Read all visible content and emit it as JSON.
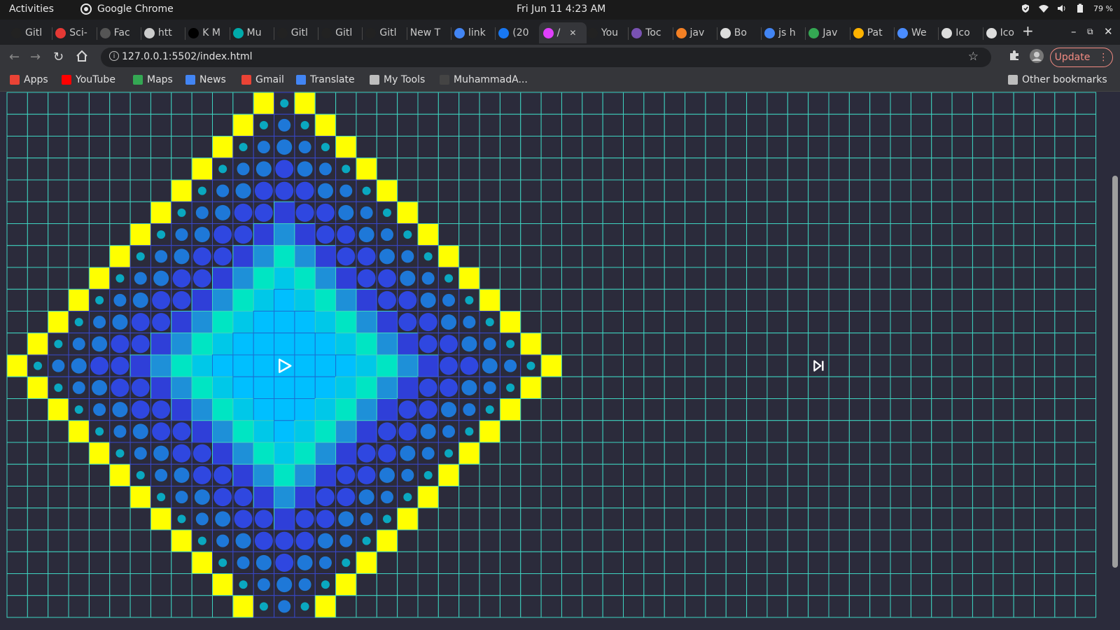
{
  "system_bar": {
    "activities": "Activities",
    "app_name": "Google Chrome",
    "clock": "Fri Jun 11   4:23 AM",
    "battery": "79 %"
  },
  "tabs": [
    {
      "label": "Gitl",
      "icon": "github-icon",
      "color": "#222222"
    },
    {
      "label": "Sci-",
      "icon": "eye-icon",
      "color": "#e53935"
    },
    {
      "label": "Fac",
      "icon": "page-icon",
      "color": "#555555"
    },
    {
      "label": "htt",
      "icon": "globe-icon",
      "color": "#cccccc"
    },
    {
      "label": "K M",
      "icon": "dev-icon",
      "color": "#000000"
    },
    {
      "label": "Mu",
      "icon": "mu-icon",
      "color": "#0aa"
    },
    {
      "label": "Gitl",
      "icon": "github-icon",
      "color": "#222222"
    },
    {
      "label": "Gitl",
      "icon": "github-icon",
      "color": "#222222"
    },
    {
      "label": "Gitl",
      "icon": "github-icon",
      "color": "#222222"
    },
    {
      "label": "New T",
      "icon": "",
      "color": ""
    },
    {
      "label": "link",
      "icon": "google-icon",
      "color": "#4285f4"
    },
    {
      "label": "(20",
      "icon": "facebook-icon",
      "color": "#1877f2"
    },
    {
      "label": "/",
      "icon": "app-icon",
      "color": "#e040fb",
      "active": true
    },
    {
      "label": "You",
      "icon": "youtube-icon",
      "color": "#222222"
    },
    {
      "label": "Toc",
      "icon": "bootstrap-icon",
      "color": "#7952b3"
    },
    {
      "label": "jav",
      "icon": "stackoverflow-icon",
      "color": "#f48024"
    },
    {
      "label": "Bo",
      "icon": "codepen-icon",
      "color": "#dddddd"
    },
    {
      "label": "js h",
      "icon": "google-icon",
      "color": "#4285f4"
    },
    {
      "label": "Jav",
      "icon": "infinity-icon",
      "color": "#34a853"
    },
    {
      "label": "Pat",
      "icon": "person-icon",
      "color": "#ffb300"
    },
    {
      "label": "We",
      "icon": "flag-icon",
      "color": "#4a8cff"
    },
    {
      "label": "Ico",
      "icon": "dot-icon",
      "color": "#dddddd"
    },
    {
      "label": "Ico",
      "icon": "globe-icon",
      "color": "#dddddd"
    }
  ],
  "toolbar": {
    "url": "127.0.0.1:5502/index.html",
    "update_label": "Update"
  },
  "bookmarks": [
    {
      "label": "Apps",
      "icon": "apps-grid-icon",
      "color": "#ea4335"
    },
    {
      "label": "YouTube",
      "icon": "youtube-icon",
      "color": "#ff0000"
    },
    {
      "label": "Maps",
      "icon": "maps-icon",
      "color": "#34a853"
    },
    {
      "label": "News",
      "icon": "news-icon",
      "color": "#4285f4"
    },
    {
      "label": "Gmail",
      "icon": "gmail-icon",
      "color": "#ea4335"
    },
    {
      "label": "Translate",
      "icon": "translate-icon",
      "color": "#4285f4"
    },
    {
      "label": "My Tools",
      "icon": "folder-icon",
      "color": "#bdbdbd"
    },
    {
      "label": "MuhammadA...",
      "icon": "github-icon",
      "color": "#444444"
    }
  ],
  "other_bookmarks": "Other bookmarks",
  "grid": {
    "columns": 53,
    "rows": 24,
    "start": {
      "col": 13,
      "row": 12,
      "icon": "play-triangle-icon"
    },
    "target": {
      "col": 39,
      "row": 12,
      "icon": "target-arrow-icon"
    },
    "colors": {
      "background": "#2b2b3b",
      "grid_line": "#3ed3c0",
      "wall_frontier": "#ffff00",
      "visited_center": "#00bfff",
      "visited_mint": "#00e5c3",
      "visited_cyan": "#00c8e8",
      "visited_blue": "#1e90d8",
      "visited_indigo": "#2f3fd8",
      "dot_teal": "#0aa8c0"
    }
  }
}
